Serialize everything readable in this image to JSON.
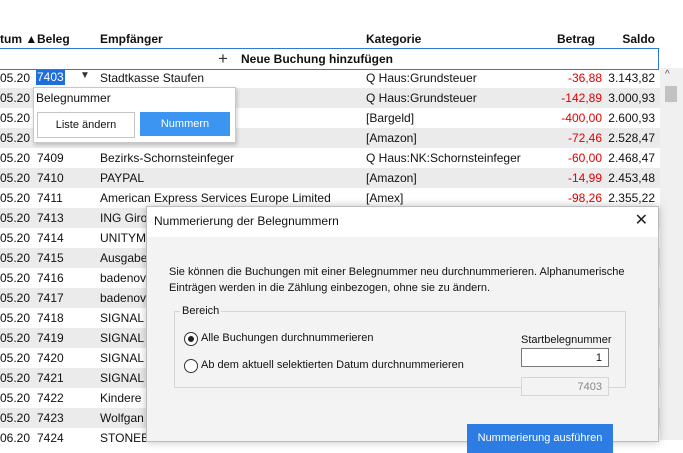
{
  "columns": {
    "datum": "tum ▲",
    "beleg": "Beleg",
    "empfaenger": "Empfänger",
    "kategorie": "Kategorie",
    "betrag": "Betrag",
    "saldo": "Saldo"
  },
  "new_booking_label": "Neue Buchung hinzufügen",
  "rows": [
    {
      "date": "05.20",
      "beleg": "7403",
      "emp": "Stadtkasse Staufen",
      "kat": "Q Haus:Grundsteuer",
      "betrag": "-36,88",
      "saldo": "3.143,82"
    },
    {
      "date": "05.20",
      "beleg": "",
      "emp": "",
      "kat": "Q Haus:Grundsteuer",
      "betrag": "-142,89",
      "saldo": "3.000,93"
    },
    {
      "date": "05.20",
      "beleg": "",
      "emp": "",
      "kat": "[Bargeld]",
      "betrag": "-400,00",
      "saldo": "2.600,93"
    },
    {
      "date": "05.20",
      "beleg": "",
      "emp": "",
      "kat": "[Amazon]",
      "betrag": "-72,46",
      "saldo": "2.528,47"
    },
    {
      "date": "05.20",
      "beleg": "7409",
      "emp": "Bezirks-Schornsteinfeger",
      "kat": "Q Haus:NK:Schornsteinfeger",
      "betrag": "-60,00",
      "saldo": "2.468,47"
    },
    {
      "date": "05.20",
      "beleg": "7410",
      "emp": "PAYPAL",
      "kat": "[Amazon]",
      "betrag": "-14,99",
      "saldo": "2.453,48"
    },
    {
      "date": "05.20",
      "beleg": "7411",
      "emp": "American Express Services Europe Limited",
      "kat": "[Amex]",
      "betrag": "-98,26",
      "saldo": "2.355,22"
    },
    {
      "date": "05.20",
      "beleg": "7413",
      "emp": "ING Giro",
      "kat": "",
      "betrag": "",
      "saldo": ""
    },
    {
      "date": "05.20",
      "beleg": "7414",
      "emp": "UNITYM",
      "kat": "",
      "betrag": "",
      "saldo": ""
    },
    {
      "date": "05.20",
      "beleg": "7415",
      "emp": "Ausgabe",
      "kat": "",
      "betrag": "",
      "saldo": ""
    },
    {
      "date": "05.20",
      "beleg": "7416",
      "emp": "badenov",
      "kat": "",
      "betrag": "",
      "saldo": ""
    },
    {
      "date": "05.20",
      "beleg": "7417",
      "emp": "badenov",
      "kat": "",
      "betrag": "",
      "saldo": ""
    },
    {
      "date": "05.20",
      "beleg": "7418",
      "emp": "SIGNAL",
      "kat": "",
      "betrag": "",
      "saldo": ""
    },
    {
      "date": "05.20",
      "beleg": "7419",
      "emp": "SIGNAL",
      "kat": "",
      "betrag": "",
      "saldo": ""
    },
    {
      "date": "05.20",
      "beleg": "7420",
      "emp": "SIGNAL",
      "kat": "",
      "betrag": "",
      "saldo": ""
    },
    {
      "date": "05.20",
      "beleg": "7421",
      "emp": "SIGNAL",
      "kat": "",
      "betrag": "",
      "saldo": ""
    },
    {
      "date": "05.20",
      "beleg": "7422",
      "emp": "Kindere",
      "kat": "",
      "betrag": "",
      "saldo": ""
    },
    {
      "date": "05.20",
      "beleg": "7423",
      "emp": "Wolfgan",
      "kat": "",
      "betrag": "",
      "saldo": ""
    },
    {
      "date": "06.20",
      "beleg": "7424",
      "emp": "STONEB",
      "kat": "",
      "betrag": "",
      "saldo": ""
    }
  ],
  "popup": {
    "title": "Belegnummer",
    "btn_change": "Liste ändern",
    "btn_number": "Nummern"
  },
  "dialog": {
    "title": "Nummerierung der Belegnummern",
    "close": "✕",
    "description": "Sie können die Buchungen mit einer Belegnummer neu durchnummerieren. Alphanumerische Einträgen werden in die Zählung einbezogen, ohne sie zu ändern.",
    "group_title": "Bereich",
    "option_all": "Alle Buchungen durchnummerieren",
    "option_date": "Ab dem aktuell selektierten Datum durchnummerieren",
    "start_label": "Startbelegnummer",
    "start_value": "1",
    "date_value": "7403",
    "execute": "Nummerierung ausführen"
  },
  "colors": {
    "accent": "#2d7ce3",
    "negative": "#e00000",
    "selected": "#1e6fd9"
  }
}
